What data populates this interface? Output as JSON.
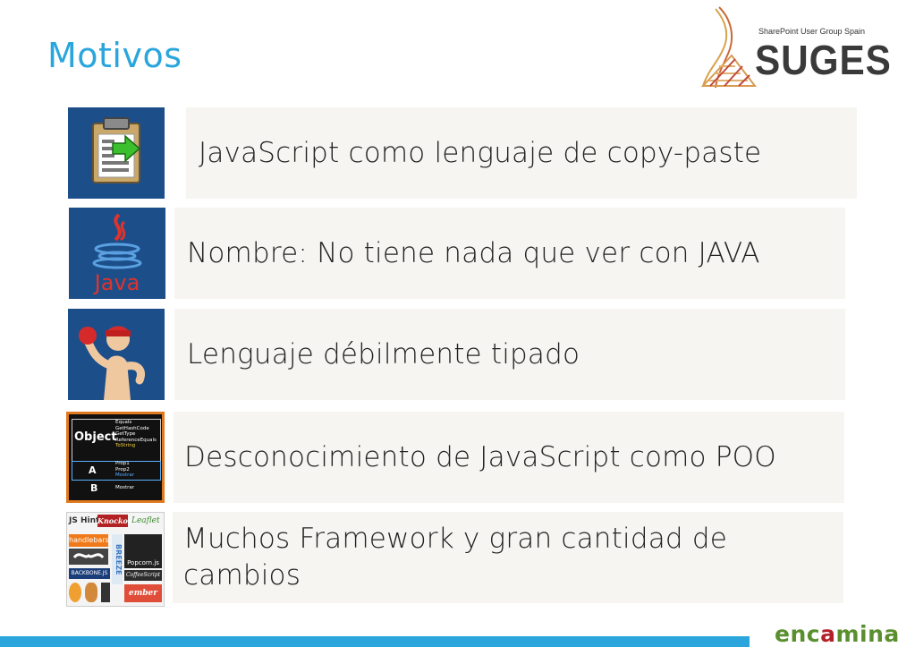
{
  "slide": {
    "title": "Motivos"
  },
  "logo": {
    "tagline": "SharePoint User Group Spain",
    "brand": "SUGES"
  },
  "items": [
    {
      "text": "JavaScript como lenguaje de copy-paste",
      "icon": "clipboard-paste-icon"
    },
    {
      "text": "Nombre: No tiene nada que ver con JAVA",
      "icon": "java-logo-icon",
      "icon_label": "Java"
    },
    {
      "text": "Lenguaje débilmente tipado",
      "icon": "boxer-icon"
    },
    {
      "text": "Desconocimiento de JavaScript como POO",
      "icon": "object-diagram-icon",
      "diagram": {
        "object_label": "Object",
        "object_methods": [
          "Equals",
          "GetHashCode",
          "GetType",
          "ReferenceEquals",
          "ToString"
        ],
        "a_label": "A",
        "a_members": [
          "Prop1",
          "Prop2",
          "Mostrar"
        ],
        "b_label": "B",
        "b_members": [
          "Mostrar"
        ]
      }
    },
    {
      "text": "Muchos Framework y gran cantidad de cambios",
      "icon": "frameworks-collage-icon",
      "logos": [
        "JS Hint",
        "Knockout",
        "Leaflet",
        "handlebars",
        "BREEZE",
        "Popcorn.js",
        "BACKBONE.JS",
        "CoffeeScript",
        "ember"
      ]
    }
  ],
  "footer": {
    "brand_part1": "enc",
    "brand_part2": "a",
    "brand_part3": "mina"
  },
  "colors": {
    "accent": "#2aa6dc",
    "icon_bg": "#1c4f8a",
    "text_bg": "#f6f5f2"
  }
}
